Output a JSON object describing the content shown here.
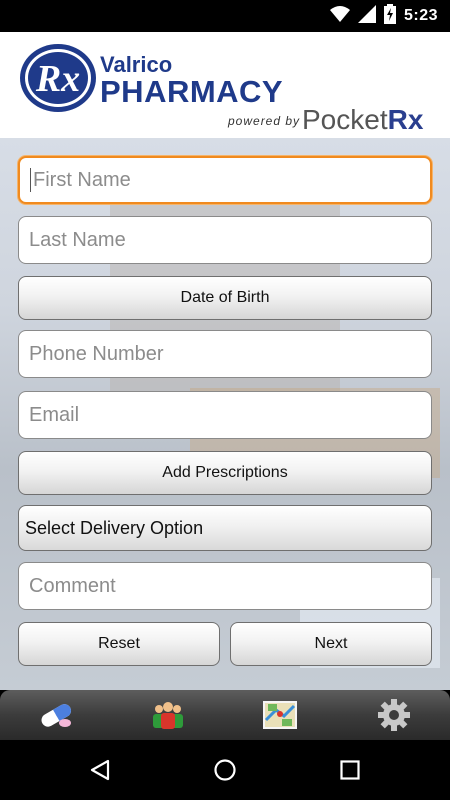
{
  "status_bar": {
    "time": "5:23",
    "icons": [
      "wifi-icon",
      "cell-signal-icon",
      "battery-charging-icon"
    ]
  },
  "header": {
    "logo_mark": "Rx",
    "brand_line1": "Valrico",
    "brand_line2": "PHARMACY",
    "powered_by": "powered by",
    "pocket": "Pocket",
    "rx": "Rx"
  },
  "form": {
    "first_name_placeholder": "First Name",
    "last_name_placeholder": "Last Name",
    "dob_label": "Date of Birth",
    "phone_placeholder": "Phone Number",
    "email_placeholder": "Email",
    "add_prescriptions_label": "Add Prescriptions",
    "delivery_option_label": "Select Delivery Option",
    "comment_placeholder": "Comment",
    "reset_label": "Reset",
    "next_label": "Next"
  },
  "tab_bar": {
    "tabs": [
      "pills-icon",
      "people-icon",
      "map-icon",
      "gear-icon"
    ]
  },
  "nav_bar": {
    "buttons": [
      "back-icon",
      "home-icon",
      "recents-icon"
    ]
  },
  "colors": {
    "brand_blue": "#1f3a8a",
    "focus_orange": "#f08a1f",
    "tab_bar_gray": "#3c3c3c"
  }
}
